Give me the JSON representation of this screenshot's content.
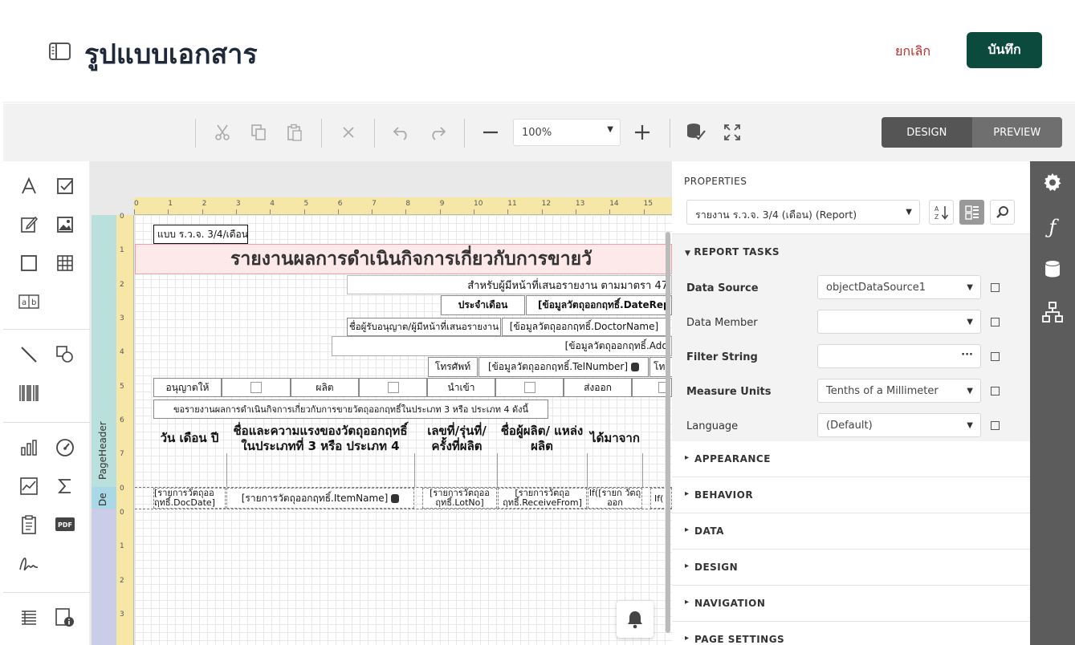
{
  "header": {
    "title": "รูปแบบเอกสาร",
    "cancel_label": "ยกเลิก",
    "save_label": "บันทึก"
  },
  "toolbar": {
    "zoom": "100%",
    "design_label": "DESIGN",
    "preview_label": "PREVIEW",
    "mode_active": "DESIGN",
    "colors": {
      "design_bg": "#555555",
      "preview_bg": "#6f6f6f"
    }
  },
  "left_tools": [
    "text-icon",
    "checkbox-icon",
    "edit-icon",
    "picture-icon",
    "rectangle-icon",
    "table-icon",
    "label-icon",
    "line-icon",
    "shapes-icon",
    "barcode-icon",
    "bar-chart-icon",
    "gauge-icon",
    "line-chart-icon",
    "sum-icon",
    "clipboard-icon",
    "pdf-icon",
    "signature-icon",
    "list-icon",
    "page-info-icon"
  ],
  "ruler": {
    "h_ticks": [
      "0",
      "1",
      "2",
      "3",
      "4",
      "5",
      "6",
      "7",
      "8",
      "9",
      "10",
      "11",
      "12",
      "13",
      "14",
      "15"
    ],
    "v_ticks_header": [
      "0",
      "1",
      "2",
      "3",
      "4",
      "5",
      "6",
      "7"
    ],
    "v_ticks_detail": [
      "0"
    ],
    "v_ticks_rest": [
      "0",
      "1",
      "2",
      "3"
    ]
  },
  "bands": {
    "page_header": "PageHeader",
    "detail": "De"
  },
  "report": {
    "form_code": "แบบ ร.ว.จ. 3/4/เดือน",
    "title": "รายงานผลการดำเนินกิจการเกี่ยวกับการขายวั",
    "subtitle": "สำหรับผู้มีหน้าที่เสนอรายงาน ตามมาตรา 47",
    "month_label": "ประจำเดือน",
    "month_field": "[ข้อมูลวัตถุออกฤทธิ์.DateRep",
    "doctor_label": "ชื่อผู้รับอนุญาต/ผู้มีหน้าที่เสนอรายงาน",
    "doctor_field": "[ข้อมูลวัตถุออกฤทธิ์.DoctorName]",
    "address_field": "[ข้อมูลวัตถุออกฤทธิ์.Add",
    "tel_label": "โทรศัพท์",
    "tel_field": "[ข้อมูลวัตถุออกฤทธิ์.TelNumber]",
    "tel_trail": "โท",
    "opt_allowed": "อนุญาตให้",
    "opt_produce": "ผลิต",
    "opt_import": "นำเข้า",
    "opt_export": "ส่งออก",
    "notice": "ขอรายงานผลการดำเนินกิจการเกี่ยวกับการขายวัตถุออกฤทธิ์ในประเภท 3 หรือ ประเภท 4 ดังนี้",
    "col_date": "วัน เดือน ปี",
    "col_name": "ชื่อและความแรงของวัตถุออกฤทธิ์ ในประเภทที่ 3 หรือ ประเภท 4",
    "col_lot": "เลขที่/รุ่นที่/ ครั้งที่ผลิต",
    "col_maker": "ชื่อผู้ผลิต/ แหล่งผลิต",
    "col_from": "ได้มาจาก",
    "row_date": "[รายการวัตถุออ ฤทธิ์.DocDate]",
    "row_item": "[รายการวัตถุออกฤทธิ์.ItemName]",
    "row_lot": "[รายการวัตถุออ ฤทธิ์.LotNo]",
    "row_maker": "[รายการวัตถุอ ฤทธิ์.ReceiveFrom]",
    "row_if1": "If([รายก วัตถุออก",
    "row_if2": "If("
  },
  "properties": {
    "heading": "PROPERTIES",
    "selector": "รายงาน ร.ว.จ. 3/4 (เดือน) (Report)",
    "tasks_heading": "REPORT TASKS",
    "rows": [
      {
        "label": "Data Source",
        "value": "objectDataSource1",
        "bold": true,
        "control": "dropdown"
      },
      {
        "label": "Data Member",
        "value": "",
        "bold": false,
        "control": "dropdown"
      },
      {
        "label": "Filter String",
        "value": "",
        "bold": true,
        "control": "ellipsis"
      },
      {
        "label": "Measure Units",
        "value": "Tenths of a Millimeter",
        "bold": true,
        "control": "dropdown"
      },
      {
        "label": "Language",
        "value": "(Default)",
        "bold": false,
        "control": "dropdown"
      }
    ],
    "sections": [
      "APPEARANCE",
      "BEHAVIOR",
      "DATA",
      "DESIGN",
      "NAVIGATION",
      "PAGE SETTINGS"
    ]
  },
  "vertical_tabs": [
    "settings-icon",
    "function-icon",
    "database-icon",
    "hierarchy-icon"
  ]
}
